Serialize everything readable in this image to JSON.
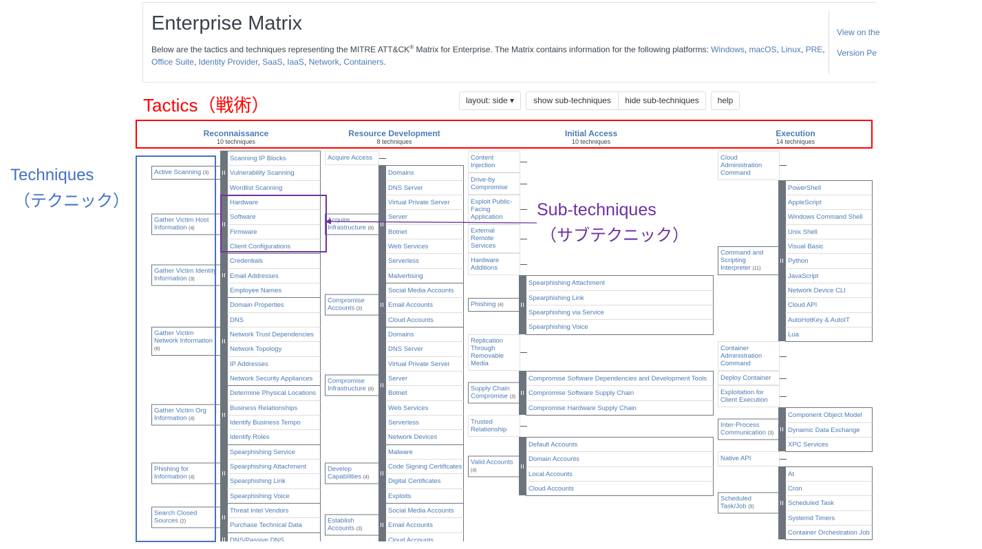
{
  "header": {
    "title": "Enterprise Matrix",
    "description_prefix": "Below are the tactics and techniques representing the MITRE ATT&CK",
    "registered_mark": "®",
    "description_suffix": " Matrix for Enterprise. The Matrix contains information for the following platforms: ",
    "platforms": [
      "Windows",
      "macOS",
      "Linux",
      "PRE",
      "Office Suite",
      "Identity Provider",
      "SaaS",
      "IaaS",
      "Network",
      "Containers"
    ],
    "side_links": [
      "View on the",
      "Version Pe"
    ]
  },
  "toolbar": {
    "layout_label": "layout: side ▾",
    "show_label": "show sub-techniques",
    "hide_label": "hide sub-techniques",
    "help_label": "help"
  },
  "annotations": {
    "tactics_label": "Tactics（戦術）",
    "techniques_line1": "Techniques",
    "techniques_line2": "（テクニック）",
    "subtechniques_line1": "Sub-techniques",
    "subtechniques_line2": "（サブテクニック）",
    "colors": {
      "tactics": "#ff0000",
      "techniques": "#4472c4",
      "subtechniques": "#7030a0"
    }
  },
  "tactics": [
    {
      "name": "Reconnaissance",
      "count_label": "10 techniques",
      "techniques": [
        {
          "name": "Active Scanning",
          "count": "(3)",
          "subs": [
            "Scanning IP Blocks",
            "Vulnerability Scanning",
            "Wordlist Scanning"
          ]
        },
        {
          "name": "Gather Victim Host Information",
          "count": "(4)",
          "subs": [
            "Hardware",
            "Software",
            "Firmware",
            "Client Configurations"
          ]
        },
        {
          "name": "Gather Victim Identity Information",
          "count": "(3)",
          "subs": [
            "Credentials",
            "Email Addresses",
            "Employee Names"
          ]
        },
        {
          "name": "Gather Victim Network Information",
          "count": "(6)",
          "subs": [
            "Domain Properties",
            "DNS",
            "Network Trust Dependencies",
            "Network Topology",
            "IP Addresses",
            "Network Security Appliances"
          ]
        },
        {
          "name": "Gather Victim Org Information",
          "count": "(4)",
          "subs": [
            "Determine Physical Locations",
            "Business Relationships",
            "Identify Business Tempo",
            "Identify Roles"
          ]
        },
        {
          "name": "Phishing for Information",
          "count": "(4)",
          "subs": [
            "Spearphishing Service",
            "Spearphishing Attachment",
            "Spearphishing Link",
            "Spearphishing Voice"
          ]
        },
        {
          "name": "Search Closed Sources",
          "count": "(2)",
          "subs": [
            "Threat Intel Vendors",
            "Purchase Technical Data"
          ]
        },
        {
          "name": null,
          "count": null,
          "subs": [
            "DNS/Passive DNS"
          ]
        }
      ]
    },
    {
      "name": "Resource Development",
      "count_label": "8 techniques",
      "techniques": [
        {
          "name": "Acquire Access",
          "count": null,
          "subs": []
        },
        {
          "name": "Acquire Infrastructure",
          "count": "(8)",
          "subs": [
            "Domains",
            "DNS Server",
            "Virtual Private Server",
            "Server",
            "Botnet",
            "Web Services",
            "Serverless",
            "Malvertising"
          ]
        },
        {
          "name": "Compromise Accounts",
          "count": "(3)",
          "subs": [
            "Social Media Accounts",
            "Email Accounts",
            "Cloud Accounts"
          ]
        },
        {
          "name": "Compromise Infrastructure",
          "count": "(8)",
          "subs": [
            "Domains",
            "DNS Server",
            "Virtual Private Server",
            "Server",
            "Botnet",
            "Web Services",
            "Serverless",
            "Network Devices"
          ]
        },
        {
          "name": "Develop Capabilities",
          "count": "(4)",
          "subs": [
            "Malware",
            "Code Signing Certificates",
            "Digital Certificates",
            "Exploits"
          ]
        },
        {
          "name": "Establish Accounts",
          "count": "(3)",
          "subs": [
            "Social Media Accounts",
            "Email Accounts",
            "Cloud Accounts"
          ]
        }
      ]
    },
    {
      "name": "Initial Access",
      "count_label": "10 techniques",
      "techniques": [
        {
          "name": "Content Injection",
          "count": null,
          "subs": []
        },
        {
          "name": "Drive-by Compromise",
          "count": null,
          "subs": []
        },
        {
          "name": "Exploit Public-Facing Application",
          "count": null,
          "subs": []
        },
        {
          "name": "External Remote Services",
          "count": null,
          "subs": []
        },
        {
          "name": "Hardware Additions",
          "count": null,
          "subs": []
        },
        {
          "name": "Phishing",
          "count": "(4)",
          "subs": [
            "Spearphishing Attachment",
            "Spearphishing Link",
            "Spearphishing via Service",
            "Spearphishing Voice"
          ]
        },
        {
          "name": "Replication Through Removable Media",
          "count": null,
          "subs": []
        },
        {
          "name": "Supply Chain Compromise",
          "count": "(3)",
          "subs": [
            "Compromise Software Dependencies and Development Tools",
            "Compromise Software Supply Chain",
            "Compromise Hardware Supply Chain"
          ]
        },
        {
          "name": "Trusted Relationship",
          "count": null,
          "subs": []
        },
        {
          "name": "Valid Accounts",
          "count": "(4)",
          "subs": [
            "Default Accounts",
            "Domain Accounts",
            "Local Accounts",
            "Cloud Accounts"
          ]
        }
      ]
    },
    {
      "name": "Execution",
      "count_label": "14 techniques",
      "techniques": [
        {
          "name": "Cloud Administration Command",
          "count": null,
          "subs": []
        },
        {
          "name": "Command and Scripting Interpreter",
          "count": "(11)",
          "subs": [
            "PowerShell",
            "AppleScript",
            "Windows Command Shell",
            "Unix Shell",
            "Visual Basic",
            "Python",
            "JavaScript",
            "Network Device CLI",
            "Cloud API",
            "AutoHotKey & AutoIT",
            "Lua"
          ]
        },
        {
          "name": "Container Administration Command",
          "count": null,
          "subs": []
        },
        {
          "name": "Deploy Container",
          "count": null,
          "subs": []
        },
        {
          "name": "Exploitation for Client Execution",
          "count": null,
          "subs": []
        },
        {
          "name": "Inter-Process Communication",
          "count": "(3)",
          "subs": [
            "Component Object Model",
            "Dynamic Data Exchange",
            "XPC Services"
          ]
        },
        {
          "name": "Native API",
          "count": null,
          "subs": []
        },
        {
          "name": "Scheduled Task/Job",
          "count": "(5)",
          "subs": [
            "At",
            "Cron",
            "Scheduled Task",
            "Systemd Timers",
            "Container Orchestration Job"
          ]
        }
      ]
    }
  ]
}
